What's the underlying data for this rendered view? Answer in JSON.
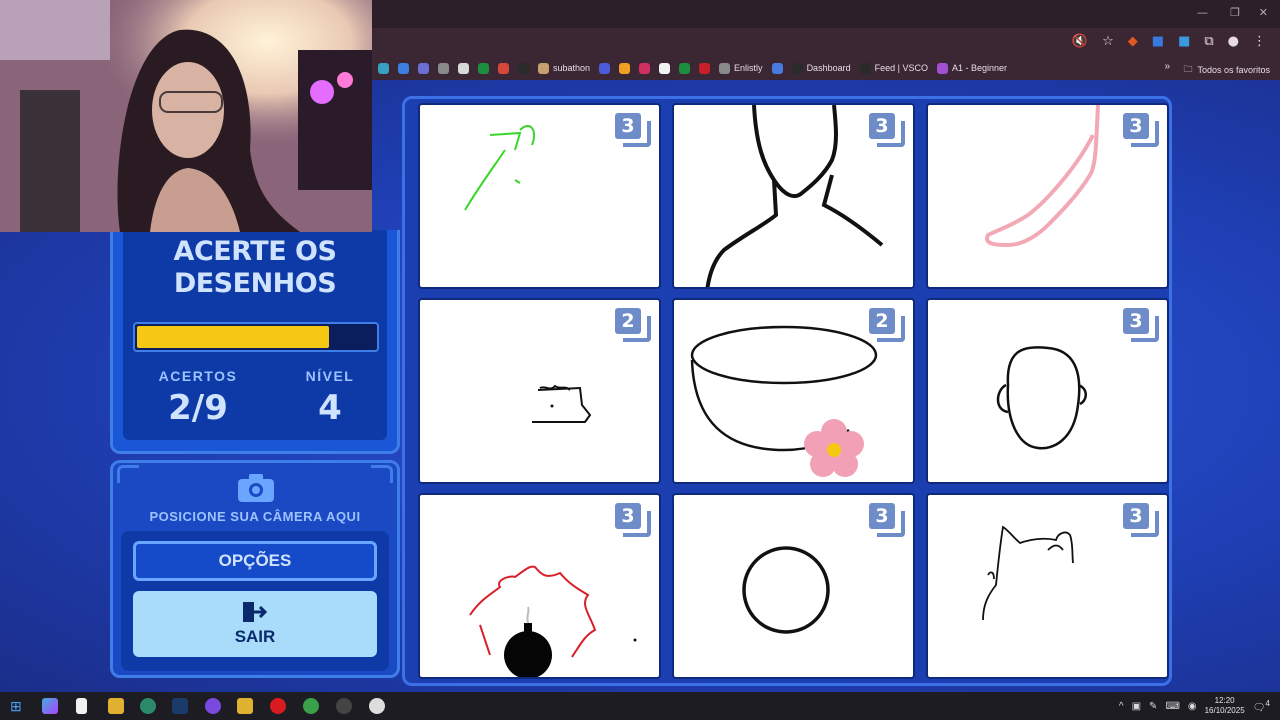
{
  "browser": {
    "bookmarks": [
      {
        "label": "",
        "color": "#39a0c4"
      },
      {
        "label": "",
        "color": "#3d7fe0"
      },
      {
        "label": "",
        "color": "#6b6fd4"
      },
      {
        "label": "",
        "color": "#8a8a8a"
      },
      {
        "label": "",
        "color": "#d8d8d8"
      },
      {
        "label": "",
        "color": "#1e8e3e"
      },
      {
        "label": "",
        "color": "#d9463a"
      },
      {
        "label": "",
        "color": "#2a2a2a"
      },
      {
        "label": "subathon",
        "color": "#c8a070"
      },
      {
        "label": "",
        "color": "#4a5ad8"
      },
      {
        "label": "",
        "color": "#f0a020"
      },
      {
        "label": "",
        "color": "#d03060"
      },
      {
        "label": "",
        "color": "#f2f2f2"
      },
      {
        "label": "",
        "color": "#1e8e3e"
      },
      {
        "label": "",
        "color": "#c8202a"
      },
      {
        "label": "Enlistly",
        "color": "#8a8a8a"
      },
      {
        "label": "",
        "color": "#4a7ae0"
      },
      {
        "label": "Dashboard",
        "color": "#2a2a2a"
      },
      {
        "label": "Feed | VSCO",
        "color": "#2a2a2a"
      },
      {
        "label": "A1 - Beginner",
        "color": "#a050d0"
      }
    ],
    "favorites_label": "Todos os favoritos"
  },
  "game": {
    "title_line1": "ACERTE OS",
    "title_line2": "DESENHOS",
    "progress_fraction": 0.8,
    "hits_label": "ACERTOS",
    "hits_value": "2/9",
    "level_label": "NÍVEL",
    "level_value": "4",
    "camera_text": "POSICIONE SUA CÂMERA AQUI",
    "options_label": "OPÇÕES",
    "exit_label": "SAIR",
    "cards": [
      {
        "badge": "3",
        "subject": "green-sketch"
      },
      {
        "badge": "3",
        "subject": "neck"
      },
      {
        "badge": "3",
        "subject": "foot"
      },
      {
        "badge": "2",
        "subject": "small-shape"
      },
      {
        "badge": "2",
        "subject": "bowl-with-flower"
      },
      {
        "badge": "3",
        "subject": "head"
      },
      {
        "badge": "3",
        "subject": "bomb-explosion"
      },
      {
        "badge": "3",
        "subject": "circle"
      },
      {
        "badge": "3",
        "subject": "cat"
      }
    ]
  },
  "taskbar": {
    "time": "12:20",
    "date": "16/10/2025",
    "notification_count": "4"
  }
}
